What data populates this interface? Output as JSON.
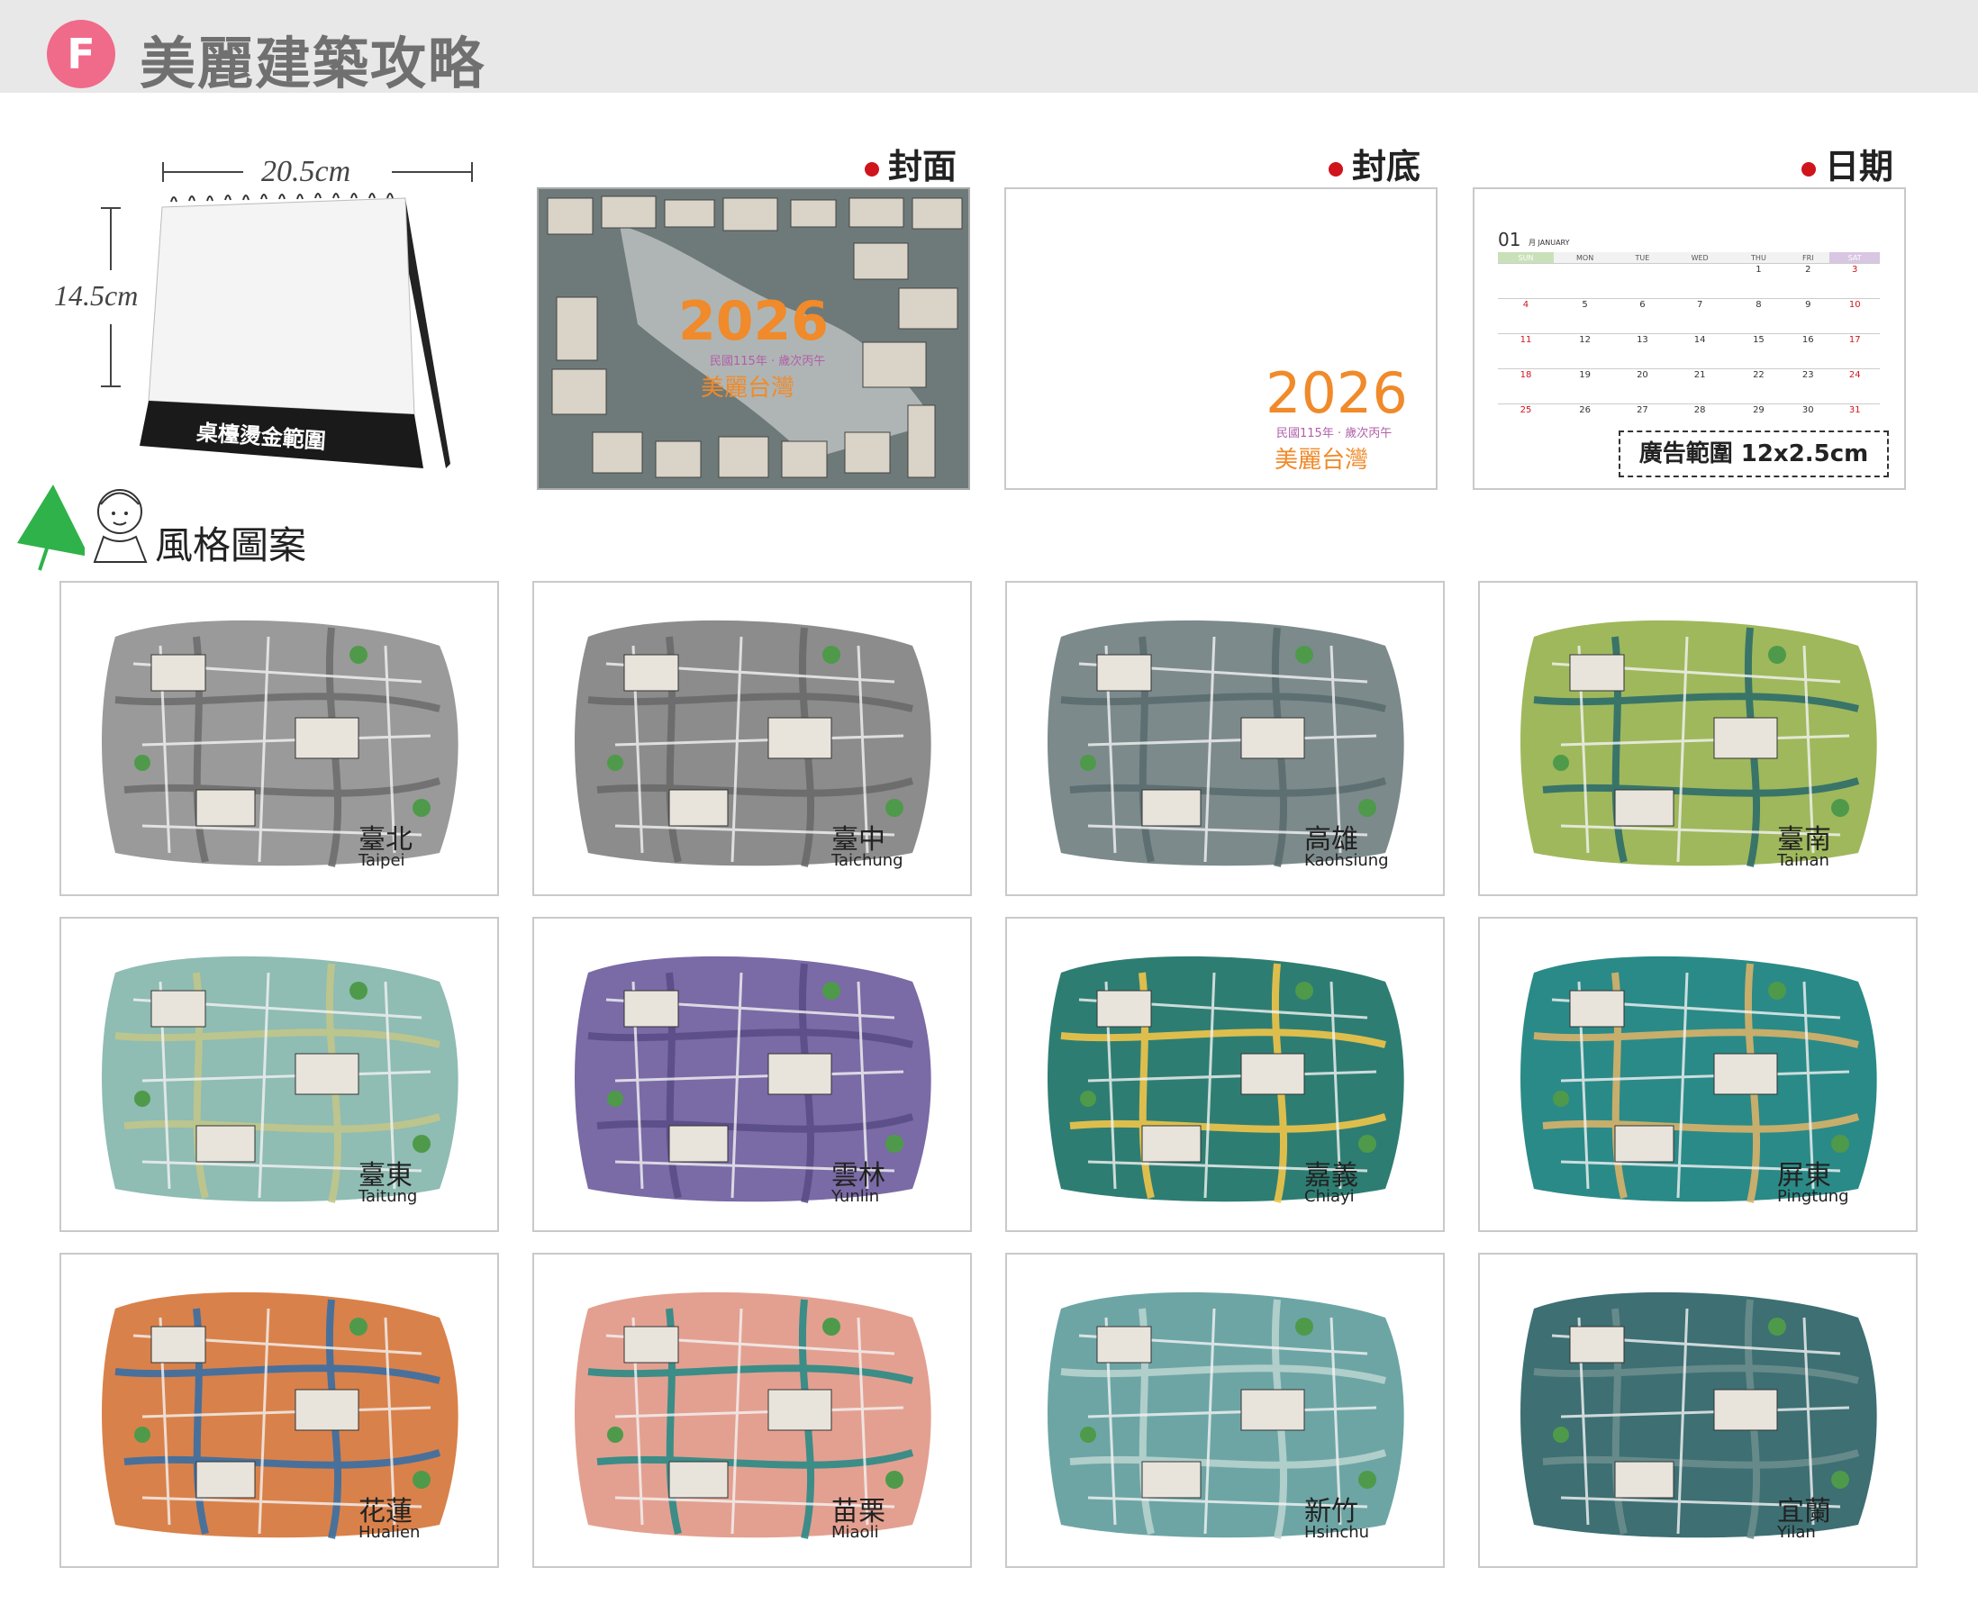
{
  "header": {
    "badge": "F",
    "title": "美麗建築攻略"
  },
  "mockup": {
    "width_label": "20.5cm",
    "height_label": "14.5cm",
    "base_text": "桌檯燙金範圍"
  },
  "sections": {
    "cover": "封面",
    "back": "封底",
    "dates": "日期"
  },
  "cover": {
    "year": "2026",
    "sub": "民國115年 · 歲次丙午",
    "name": "美麗台灣"
  },
  "back": {
    "year": "2026",
    "sub": "民國115年 · 歲次丙午",
    "name": "美麗台灣"
  },
  "calendar": {
    "month_num": "01",
    "month_txt": "月 JANUARY",
    "weekdays": [
      "SUN",
      "MON",
      "TUE",
      "WED",
      "THU",
      "FRI",
      "SAT"
    ],
    "rows": [
      [
        "",
        "",
        "",
        "",
        "1",
        "2",
        "3"
      ],
      [
        "4",
        "5",
        "6",
        "7",
        "8",
        "9",
        "10"
      ],
      [
        "11",
        "12",
        "13",
        "14",
        "15",
        "16",
        "17"
      ],
      [
        "18",
        "19",
        "20",
        "21",
        "22",
        "23",
        "24"
      ],
      [
        "25",
        "26",
        "27",
        "28",
        "29",
        "30",
        "31"
      ]
    ],
    "ad_label": "廣告範圍 12x2.5cm"
  },
  "style_label": "風格圖案",
  "maps": [
    {
      "cn": "臺北",
      "en": "Taipei",
      "palette": [
        "#9a9a9a",
        "#6e6e6e",
        "#3a3a3a"
      ]
    },
    {
      "cn": "臺中",
      "en": "Taichung",
      "palette": [
        "#8c8c8c",
        "#6a6a6a",
        "#c3a7a7"
      ]
    },
    {
      "cn": "高雄",
      "en": "Kaohsiung",
      "palette": [
        "#7c8a8c",
        "#5b6d6f",
        "#2f5b61"
      ]
    },
    {
      "cn": "臺南",
      "en": "Tainan",
      "palette": [
        "#9fb85c",
        "#2f6d6a",
        "#cfd98a"
      ]
    },
    {
      "cn": "臺東",
      "en": "Taitung",
      "palette": [
        "#8fbcb3",
        "#c1c78a",
        "#6a9fb5"
      ]
    },
    {
      "cn": "雲林",
      "en": "Yunlin",
      "palette": [
        "#7a6aa5",
        "#5a4d86",
        "#e0c35a"
      ]
    },
    {
      "cn": "嘉義",
      "en": "Chiayi",
      "palette": [
        "#2e7d72",
        "#f1c64a",
        "#3a9a88"
      ]
    },
    {
      "cn": "屏東",
      "en": "Pingtung",
      "palette": [
        "#2a8a87",
        "#d9b36a",
        "#8fc6c0"
      ]
    },
    {
      "cn": "花蓮",
      "en": "Hualien",
      "palette": [
        "#d9814b",
        "#3a6fa3",
        "#8fa65a"
      ]
    },
    {
      "cn": "苗栗",
      "en": "Miaoli",
      "palette": [
        "#e3a090",
        "#2a8a87",
        "#cf7c74"
      ]
    },
    {
      "cn": "新竹",
      "en": "Hsinchu",
      "palette": [
        "#6da5a5",
        "#b8d3cf",
        "#3d7a7c"
      ]
    },
    {
      "cn": "宜蘭",
      "en": "Yilan",
      "palette": [
        "#3d6f73",
        "#6a8d8c",
        "#2c4d50"
      ]
    }
  ]
}
